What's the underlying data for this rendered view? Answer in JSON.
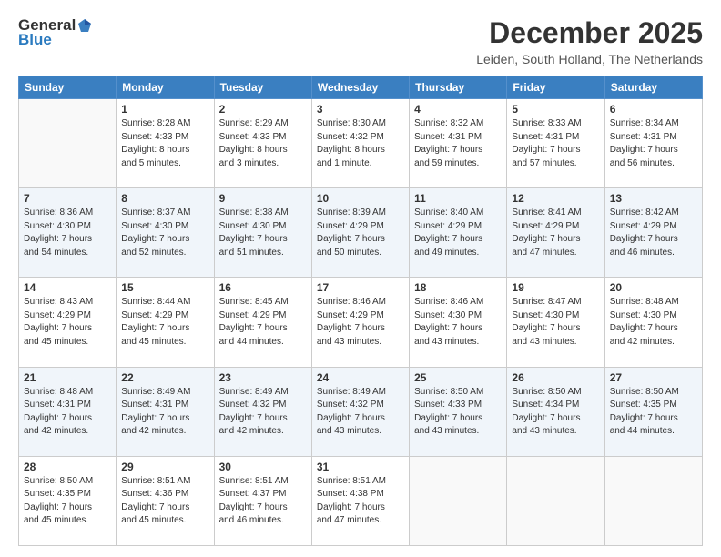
{
  "logo": {
    "general": "General",
    "blue": "Blue"
  },
  "title": "December 2025",
  "location": "Leiden, South Holland, The Netherlands",
  "days_of_week": [
    "Sunday",
    "Monday",
    "Tuesday",
    "Wednesday",
    "Thursday",
    "Friday",
    "Saturday"
  ],
  "weeks": [
    [
      {
        "day": "",
        "info": ""
      },
      {
        "day": "1",
        "info": "Sunrise: 8:28 AM\nSunset: 4:33 PM\nDaylight: 8 hours\nand 5 minutes."
      },
      {
        "day": "2",
        "info": "Sunrise: 8:29 AM\nSunset: 4:33 PM\nDaylight: 8 hours\nand 3 minutes."
      },
      {
        "day": "3",
        "info": "Sunrise: 8:30 AM\nSunset: 4:32 PM\nDaylight: 8 hours\nand 1 minute."
      },
      {
        "day": "4",
        "info": "Sunrise: 8:32 AM\nSunset: 4:31 PM\nDaylight: 7 hours\nand 59 minutes."
      },
      {
        "day": "5",
        "info": "Sunrise: 8:33 AM\nSunset: 4:31 PM\nDaylight: 7 hours\nand 57 minutes."
      },
      {
        "day": "6",
        "info": "Sunrise: 8:34 AM\nSunset: 4:31 PM\nDaylight: 7 hours\nand 56 minutes."
      }
    ],
    [
      {
        "day": "7",
        "info": "Sunrise: 8:36 AM\nSunset: 4:30 PM\nDaylight: 7 hours\nand 54 minutes."
      },
      {
        "day": "8",
        "info": "Sunrise: 8:37 AM\nSunset: 4:30 PM\nDaylight: 7 hours\nand 52 minutes."
      },
      {
        "day": "9",
        "info": "Sunrise: 8:38 AM\nSunset: 4:30 PM\nDaylight: 7 hours\nand 51 minutes."
      },
      {
        "day": "10",
        "info": "Sunrise: 8:39 AM\nSunset: 4:29 PM\nDaylight: 7 hours\nand 50 minutes."
      },
      {
        "day": "11",
        "info": "Sunrise: 8:40 AM\nSunset: 4:29 PM\nDaylight: 7 hours\nand 49 minutes."
      },
      {
        "day": "12",
        "info": "Sunrise: 8:41 AM\nSunset: 4:29 PM\nDaylight: 7 hours\nand 47 minutes."
      },
      {
        "day": "13",
        "info": "Sunrise: 8:42 AM\nSunset: 4:29 PM\nDaylight: 7 hours\nand 46 minutes."
      }
    ],
    [
      {
        "day": "14",
        "info": "Sunrise: 8:43 AM\nSunset: 4:29 PM\nDaylight: 7 hours\nand 45 minutes."
      },
      {
        "day": "15",
        "info": "Sunrise: 8:44 AM\nSunset: 4:29 PM\nDaylight: 7 hours\nand 45 minutes."
      },
      {
        "day": "16",
        "info": "Sunrise: 8:45 AM\nSunset: 4:29 PM\nDaylight: 7 hours\nand 44 minutes."
      },
      {
        "day": "17",
        "info": "Sunrise: 8:46 AM\nSunset: 4:29 PM\nDaylight: 7 hours\nand 43 minutes."
      },
      {
        "day": "18",
        "info": "Sunrise: 8:46 AM\nSunset: 4:30 PM\nDaylight: 7 hours\nand 43 minutes."
      },
      {
        "day": "19",
        "info": "Sunrise: 8:47 AM\nSunset: 4:30 PM\nDaylight: 7 hours\nand 43 minutes."
      },
      {
        "day": "20",
        "info": "Sunrise: 8:48 AM\nSunset: 4:30 PM\nDaylight: 7 hours\nand 42 minutes."
      }
    ],
    [
      {
        "day": "21",
        "info": "Sunrise: 8:48 AM\nSunset: 4:31 PM\nDaylight: 7 hours\nand 42 minutes."
      },
      {
        "day": "22",
        "info": "Sunrise: 8:49 AM\nSunset: 4:31 PM\nDaylight: 7 hours\nand 42 minutes."
      },
      {
        "day": "23",
        "info": "Sunrise: 8:49 AM\nSunset: 4:32 PM\nDaylight: 7 hours\nand 42 minutes."
      },
      {
        "day": "24",
        "info": "Sunrise: 8:49 AM\nSunset: 4:32 PM\nDaylight: 7 hours\nand 43 minutes."
      },
      {
        "day": "25",
        "info": "Sunrise: 8:50 AM\nSunset: 4:33 PM\nDaylight: 7 hours\nand 43 minutes."
      },
      {
        "day": "26",
        "info": "Sunrise: 8:50 AM\nSunset: 4:34 PM\nDaylight: 7 hours\nand 43 minutes."
      },
      {
        "day": "27",
        "info": "Sunrise: 8:50 AM\nSunset: 4:35 PM\nDaylight: 7 hours\nand 44 minutes."
      }
    ],
    [
      {
        "day": "28",
        "info": "Sunrise: 8:50 AM\nSunset: 4:35 PM\nDaylight: 7 hours\nand 45 minutes."
      },
      {
        "day": "29",
        "info": "Sunrise: 8:51 AM\nSunset: 4:36 PM\nDaylight: 7 hours\nand 45 minutes."
      },
      {
        "day": "30",
        "info": "Sunrise: 8:51 AM\nSunset: 4:37 PM\nDaylight: 7 hours\nand 46 minutes."
      },
      {
        "day": "31",
        "info": "Sunrise: 8:51 AM\nSunset: 4:38 PM\nDaylight: 7 hours\nand 47 minutes."
      },
      {
        "day": "",
        "info": ""
      },
      {
        "day": "",
        "info": ""
      },
      {
        "day": "",
        "info": ""
      }
    ]
  ]
}
